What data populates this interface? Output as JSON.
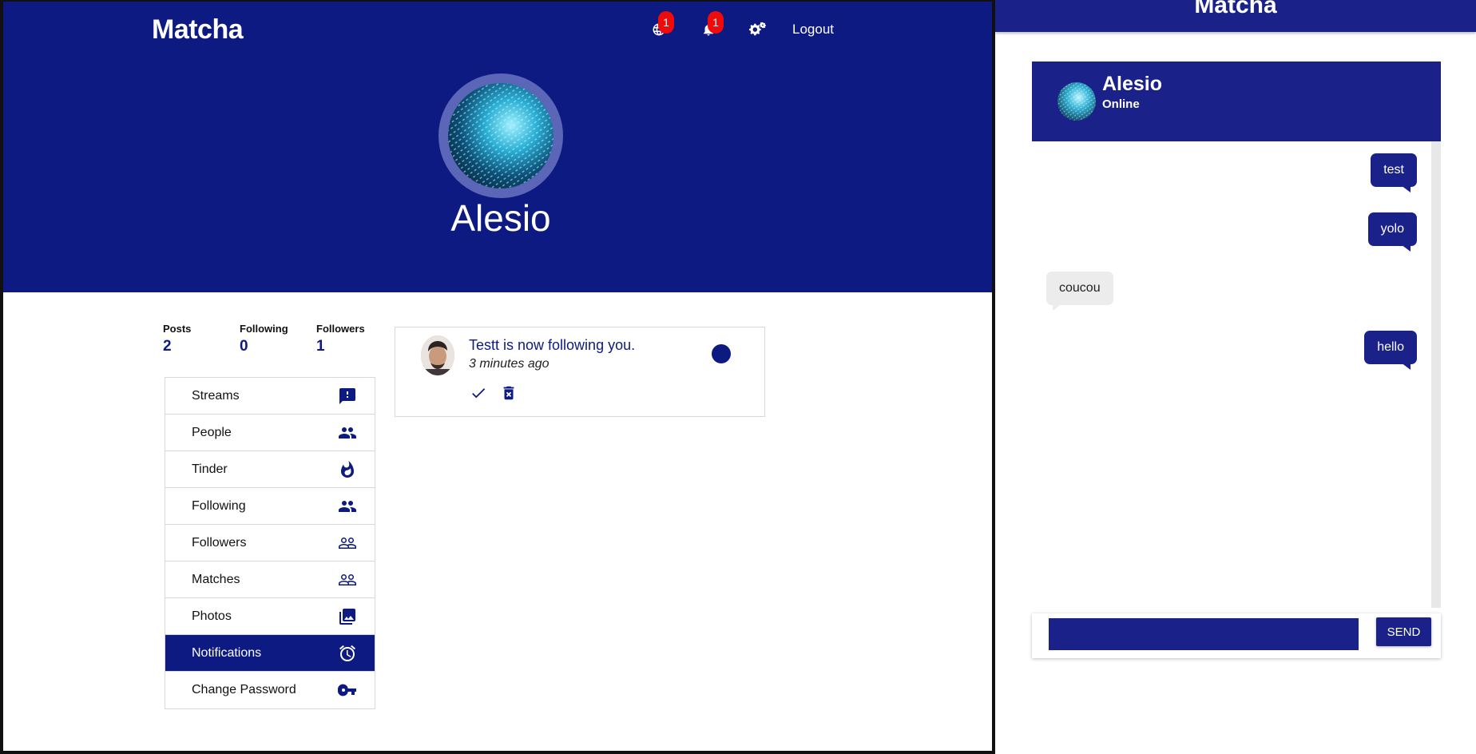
{
  "left": {
    "brand": "Matcha",
    "nav": {
      "globe_badge": "1",
      "bell_badge": "1",
      "logout": "Logout"
    },
    "profile": {
      "name": "Alesio"
    },
    "stats": [
      {
        "label": "Posts",
        "value": "2"
      },
      {
        "label": "Following",
        "value": "0"
      },
      {
        "label": "Followers",
        "value": "1"
      }
    ],
    "menu": [
      {
        "label": "Streams",
        "icon": "feedback-icon"
      },
      {
        "label": "People",
        "icon": "people-icon"
      },
      {
        "label": "Tinder",
        "icon": "flame-icon"
      },
      {
        "label": "Following",
        "icon": "people-icon"
      },
      {
        "label": "Followers",
        "icon": "people-outline-icon"
      },
      {
        "label": "Matches",
        "icon": "people-outline-icon"
      },
      {
        "label": "Photos",
        "icon": "photo-library-icon"
      },
      {
        "label": "Notifications",
        "icon": "alarm-icon",
        "active": true
      },
      {
        "label": "Change Password",
        "icon": "key-icon"
      }
    ],
    "notification": {
      "text": "Testt is now following you.",
      "time": "3 minutes ago"
    }
  },
  "right": {
    "brand": "Matcha",
    "chat": {
      "name": "Alesio",
      "status": "Online",
      "messages": [
        {
          "text": "test",
          "from": "me"
        },
        {
          "text": "yolo",
          "from": "me"
        },
        {
          "text": "coucou",
          "from": "them"
        },
        {
          "text": "hello",
          "from": "me"
        }
      ],
      "input_value": "",
      "send_label": "SEND"
    }
  },
  "colors": {
    "primary": "#0d1a82",
    "chat_primary": "#1a2289",
    "badge": "#f00b0b",
    "incoming_bubble": "#ececec"
  }
}
